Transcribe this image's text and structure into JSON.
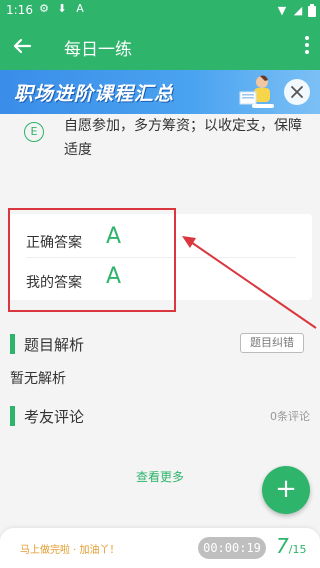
{
  "status_bar": {
    "time": "1:16",
    "icons": [
      "settings-icon",
      "download-icon",
      "app-a-icon",
      "wifi-icon",
      "signal-icon",
      "battery-icon"
    ]
  },
  "app_bar": {
    "title": "每日一练"
  },
  "banner": {
    "text": "职场进阶课程汇总"
  },
  "option": {
    "letter": "E",
    "text": "自愿参加，多方筹资；以收定支，保障适度"
  },
  "answers": {
    "correct_label": "正确答案",
    "correct_value": "A",
    "mine_label": "我的答案",
    "mine_value": "A"
  },
  "analysis": {
    "title": "题目解析",
    "fix_button": "题目纠错",
    "content": "暂无解析"
  },
  "comments": {
    "title": "考友评论",
    "count": "0条评论"
  },
  "see_more": "查看更多",
  "fab": {
    "label": "+"
  },
  "bottom": {
    "encourage": "马上做完啦 · 加油丫！",
    "timer": "00:00:19",
    "current": "7",
    "total": "/15"
  },
  "colors": {
    "accent": "#2fb46b",
    "highlight": "#d9363e",
    "timer_bg": "#bfbfbf",
    "encourage": "#e39b2a"
  }
}
